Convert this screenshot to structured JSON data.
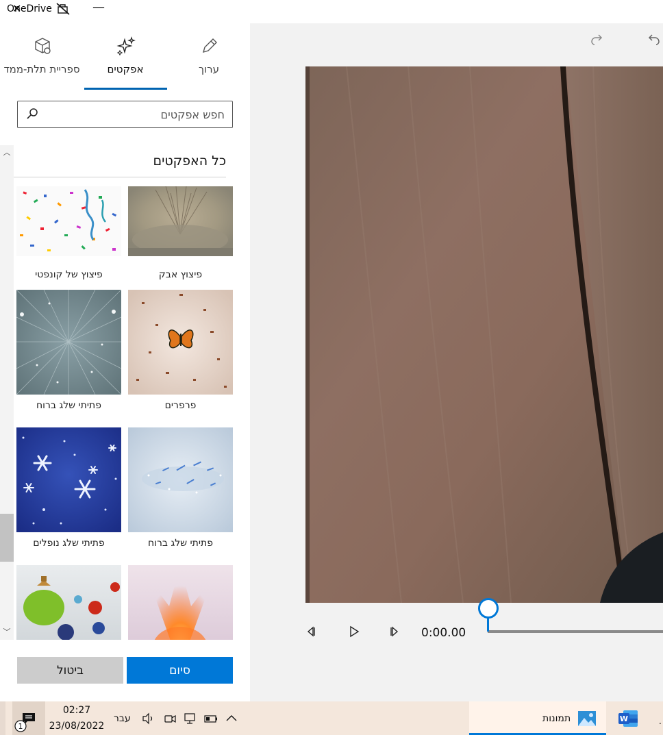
{
  "titlebar": {
    "app_label": "OneDrive",
    "minimize_glyph": "—"
  },
  "panel": {
    "tabs": [
      {
        "id": "3d",
        "label": "ספריית תלת-ממד",
        "icon": "cube-icon"
      },
      {
        "id": "effects",
        "label": "אפקטים",
        "icon": "sparkle-icon",
        "selected": true
      },
      {
        "id": "edit",
        "label": "ערוך",
        "icon": "pencil-icon"
      }
    ],
    "search": {
      "placeholder": "חפש אפקטים",
      "value": ""
    },
    "section_title": "כל האפקטים",
    "effects": [
      {
        "label": "פיצוץ אבק",
        "thumb": "dust-explosion"
      },
      {
        "label": "פיצוץ של קונפטי",
        "thumb": "confetti"
      },
      {
        "label": "פרפרים",
        "thumb": "butterflies"
      },
      {
        "label": "פתיתי שלג ברוח",
        "thumb": "snow-burst"
      },
      {
        "label": "פתיתי שלג ברוח",
        "thumb": "windy-snow"
      },
      {
        "label": "פתיתי שלג נופלים",
        "thumb": "falling-snow"
      },
      {
        "label": "",
        "thumb": "fire-burst"
      },
      {
        "label": "",
        "thumb": "ornaments"
      }
    ],
    "done_label": "סיום",
    "cancel_label": "ביטול"
  },
  "player": {
    "time": "0:00.00",
    "progress": 0
  },
  "taskbar": {
    "time": "02:27",
    "date": "23/08/2022",
    "language": "עבר",
    "apps": [
      {
        "label": "תמונות",
        "icon": "photos-icon",
        "active": true
      },
      {
        "label": "",
        "icon": "word-icon",
        "active": false
      }
    ],
    "more_glyph": "."
  },
  "colors": {
    "accent": "#0078d7",
    "tab_underline": "#0063b1",
    "taskbar": "#f4e7dc"
  }
}
